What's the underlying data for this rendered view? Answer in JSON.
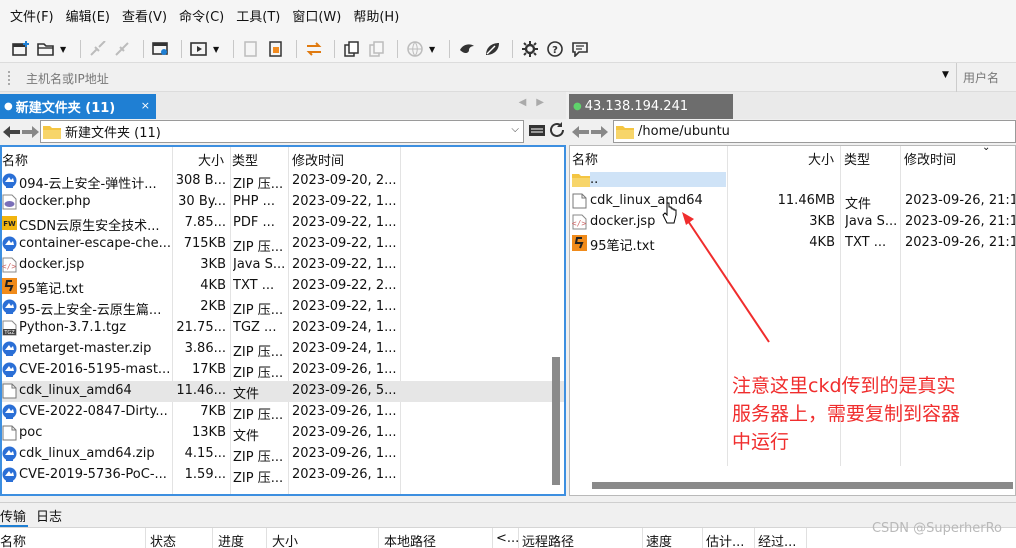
{
  "menu": [
    "文件(F)",
    "编辑(E)",
    "查看(V)",
    "命令(C)",
    "工具(T)",
    "窗口(W)",
    "帮助(H)"
  ],
  "toolbar_icons": [
    "new-session-icon",
    "open-folder-icon",
    "disconnect-icon",
    "reconnect-icon",
    "session-manager-icon",
    "play-icon",
    "copy-icon",
    "paste-icon",
    "transfer-icon",
    "duplicate-icon",
    "clipboard-icon",
    "globe-icon",
    "bird-icon",
    "leaf-icon",
    "gear-icon",
    "help-icon",
    "chat-icon"
  ],
  "hostbar": {
    "host_placeholder": "主机名或IP地址",
    "user_placeholder": "用户名"
  },
  "left": {
    "tab_title": "新建文件夹 (11)",
    "path": "新建文件夹 (11)",
    "columns": [
      "名称",
      "大小",
      "类型",
      "修改时间"
    ],
    "files": [
      {
        "name": "094-云上安全-弹性计...",
        "size": "308 B...",
        "type": "ZIP 压...",
        "date": "2023-09-20, 2...",
        "icon": "zip"
      },
      {
        "name": "docker.php",
        "size": "30 By...",
        "type": "PHP ...",
        "date": "2023-09-22, 1...",
        "icon": "php"
      },
      {
        "name": "CSDN云原生安全技术...",
        "size": "7.85...",
        "type": "PDF ...",
        "date": "2023-09-22, 1...",
        "icon": "pdf"
      },
      {
        "name": "container-escape-che...",
        "size": "715KB",
        "type": "ZIP 压...",
        "date": "2023-09-22, 1...",
        "icon": "zip"
      },
      {
        "name": "docker.jsp",
        "size": "3KB",
        "type": "Java S...",
        "date": "2023-09-22, 1...",
        "icon": "jsp"
      },
      {
        "name": "95笔记.txt",
        "size": "4KB",
        "type": "TXT ...",
        "date": "2023-09-22, 2...",
        "icon": "txt"
      },
      {
        "name": "95-云上安全-云原生篇...",
        "size": "2KB",
        "type": "ZIP 压...",
        "date": "2023-09-22, 1...",
        "icon": "zip"
      },
      {
        "name": "Python-3.7.1.tgz",
        "size": "21.75...",
        "type": "TGZ ...",
        "date": "2023-09-24, 1...",
        "icon": "tgz"
      },
      {
        "name": "metarget-master.zip",
        "size": "3.86...",
        "type": "ZIP 压...",
        "date": "2023-09-24, 1...",
        "icon": "zip"
      },
      {
        "name": "CVE-2016-5195-mast...",
        "size": "17KB",
        "type": "ZIP 压...",
        "date": "2023-09-26, 1...",
        "icon": "zip"
      },
      {
        "name": "cdk_linux_amd64",
        "size": "11.46...",
        "type": "文件",
        "date": "2023-09-26, 5...",
        "icon": "file"
      },
      {
        "name": "CVE-2022-0847-Dirty...",
        "size": "7KB",
        "type": "ZIP 压...",
        "date": "2023-09-26, 1...",
        "icon": "zip"
      },
      {
        "name": "poc",
        "size": "13KB",
        "type": "文件",
        "date": "2023-09-26, 1...",
        "icon": "file"
      },
      {
        "name": "cdk_linux_amd64.zip",
        "size": "4.15...",
        "type": "ZIP 压...",
        "date": "2023-09-26, 1...",
        "icon": "zip"
      },
      {
        "name": "CVE-2019-5736-PoC-...",
        "size": "1.59...",
        "type": "ZIP 压...",
        "date": "2023-09-26, 1...",
        "icon": "zip"
      }
    ]
  },
  "right": {
    "tab_title": "43.138.194.241",
    "path": "/home/ubuntu",
    "columns": [
      "名称",
      "大小",
      "类型",
      "修改时间"
    ],
    "files": [
      {
        "name": "..",
        "size": "",
        "type": "",
        "date": "",
        "icon": "folder"
      },
      {
        "name": "cdk_linux_amd64",
        "size": "11.46MB",
        "type": "文件",
        "date": "2023-09-26, 21:1",
        "icon": "file"
      },
      {
        "name": "docker.jsp",
        "size": "3KB",
        "type": "Java S...",
        "date": "2023-09-26, 21:1",
        "icon": "jsp"
      },
      {
        "name": "95笔记.txt",
        "size": "4KB",
        "type": "TXT ...",
        "date": "2023-09-26, 21:1",
        "icon": "txt"
      }
    ]
  },
  "annotation": [
    "注意这里ckd传到的是真实",
    "服务器上，需要复制到容器",
    "中运行"
  ],
  "bottom": {
    "tabs": [
      "传输",
      "日志"
    ],
    "columns": [
      "名称",
      "状态",
      "进度",
      "大小",
      "本地路径",
      "<...",
      "远程路径",
      "速度",
      "估计...",
      "经过..."
    ]
  },
  "watermark": "CSDN @SuperherRo",
  "colors": {
    "accent": "#1f7fd3",
    "annotation": "#f02d2d"
  }
}
